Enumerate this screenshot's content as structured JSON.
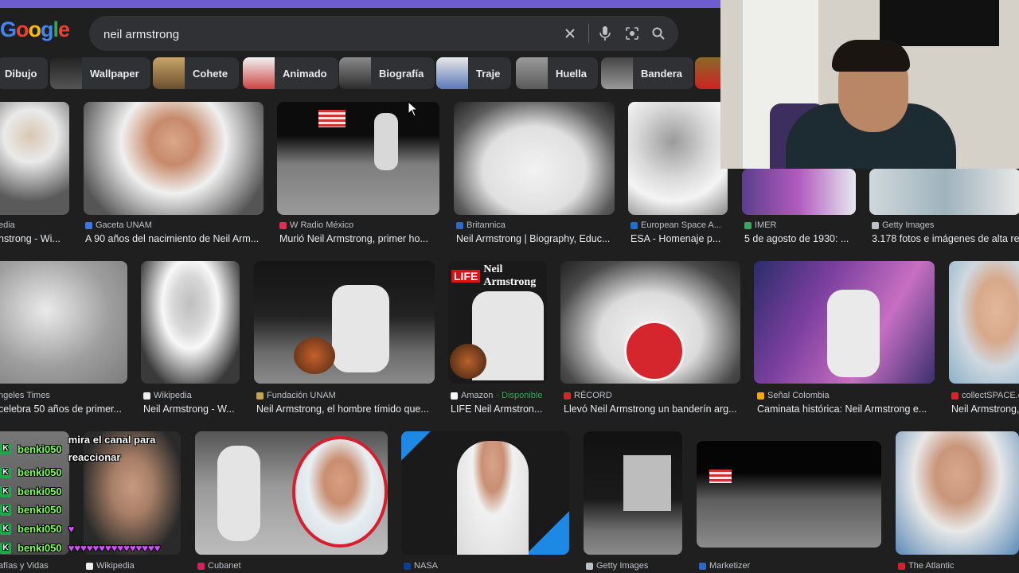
{
  "logo": {
    "text": "Google"
  },
  "search": {
    "query": "neil armstrong"
  },
  "icons": {
    "clear": "close-icon",
    "voice": "mic-icon",
    "lens": "camera-lens-icon",
    "search": "search-icon"
  },
  "chips": [
    {
      "label": "Dibujo"
    },
    {
      "label": "Wallpaper"
    },
    {
      "label": "Cohete"
    },
    {
      "label": "Animado"
    },
    {
      "label": "Biografía"
    },
    {
      "label": "Traje"
    },
    {
      "label": "Huella"
    },
    {
      "label": "Bandera"
    }
  ],
  "row1": [
    {
      "source": "edia",
      "title": "nstrong - Wi..."
    },
    {
      "source": "Gaceta UNAM",
      "title": "A 90 años del nacimiento de Neil Arm..."
    },
    {
      "source": "W Radio México",
      "title": "Murió Neil Armstrong, primer ho..."
    },
    {
      "source": "Britannica",
      "title": "Neil Armstrong | Biography, Educ..."
    },
    {
      "source": "European Space A...",
      "title": "ESA - Homenaje p..."
    },
    {
      "source": "IMER",
      "title": "5 de agosto de 1930: ..."
    },
    {
      "source": "Getty Images",
      "title": "3.178 fotos e imágenes de alta re"
    }
  ],
  "row2": [
    {
      "source": "ngeles Times",
      "title": "celebra 50 años de primer..."
    },
    {
      "source": "Wikipedia",
      "title": "Neil Armstrong - W..."
    },
    {
      "source": "Fundación UNAM",
      "title": "Neil Armstrong, el hombre tímido que..."
    },
    {
      "source": "Amazon",
      "availability": " · Disponible",
      "title": "LIFE Neil Armstron..."
    },
    {
      "source": "RÉCORD",
      "title": "Llevó Neil Armstrong un banderín arg..."
    },
    {
      "source": "Señal Colombia",
      "title": "Caminata histórica: Neil Armstrong e..."
    },
    {
      "source": "collectSPACE.c",
      "title": "Neil Armstrong,"
    }
  ],
  "row3": [
    {
      "source": "afías y Vidas"
    },
    {
      "source": "Wikipedia"
    },
    {
      "source": "Cubanet"
    },
    {
      "source": "NASA"
    },
    {
      "source": "Getty Images"
    },
    {
      "source": "Marketizer"
    },
    {
      "source": "The Atlantic"
    }
  ],
  "life_cover": {
    "brand": "LIFE",
    "name": "Neil Armstrong"
  },
  "chat": {
    "lines": [
      {
        "user": "benki050",
        "message": "mira el canal para reaccionar"
      },
      {
        "user": "benki050",
        "message": ""
      },
      {
        "user": "benki050",
        "message": ""
      },
      {
        "user": "benki050",
        "message": ""
      },
      {
        "user": "benki050",
        "message": ""
      },
      {
        "user": "benki050",
        "message": ""
      }
    ],
    "hearts": "♥♥♥♥♥♥♥♥♥♥♥♥♥♥♥"
  }
}
